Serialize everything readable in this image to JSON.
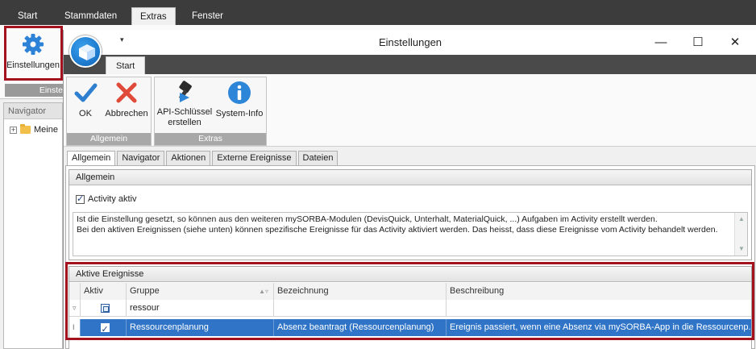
{
  "main": {
    "tabs": [
      {
        "label": "Start"
      },
      {
        "label": "Stammdaten"
      },
      {
        "label": "Extras"
      },
      {
        "label": "Fenster"
      }
    ],
    "ribbon_button": {
      "label": "Einstellungen",
      "icon": "gear-icon"
    },
    "group_caption": "Einste",
    "navigator": {
      "header": "Navigator",
      "item": "Meine"
    }
  },
  "dialog": {
    "title": "Einstellungen",
    "quick_access": "▾",
    "window_buttons": {
      "minimize": "—",
      "maximize": "☐",
      "close": "✕"
    },
    "ribbon_tab": "Start",
    "groups": [
      {
        "caption": "Allgemein",
        "buttons": [
          {
            "label": "OK",
            "icon": "checkmark-icon"
          },
          {
            "label": "Abbrechen",
            "icon": "cancel-x-icon"
          }
        ]
      },
      {
        "caption": "Extras",
        "buttons": [
          {
            "label": "API-Schlüssel erstellen",
            "line1": "API-Schlüssel",
            "line2": "erstellen",
            "icon": "key-icon"
          },
          {
            "label": "System-Info",
            "icon": "info-icon"
          }
        ]
      }
    ],
    "sub_tabs": [
      "Allgemein",
      "Navigator",
      "Aktionen",
      "Externe Ereignisse",
      "Dateien"
    ],
    "general": {
      "header": "Allgemein",
      "checkbox_label": "Activity aktiv",
      "checkbox_checked": true,
      "description_line1": "Ist die Einstellung gesetzt, so können aus den weiteren mySORBA-Modulen (DevisQuick, Unterhalt, MaterialQuick, ...) Aufgaben im Activity erstellt werden.",
      "description_line2": "Bei den aktiven Ereignissen (siehe unten) können spezifische Ereignisse für das Activity aktiviert werden. Das heisst, dass diese Ereignisse vom Activity behandelt werden."
    },
    "events": {
      "header": "Aktive Ereignisse",
      "columns": [
        "Aktiv",
        "Gruppe",
        "Bezeichnung",
        "Beschreibung"
      ],
      "filter_row": {
        "gruppe": "ressour",
        "bezeichnung": "",
        "beschreibung": ""
      },
      "rows": [
        {
          "aktiv": true,
          "gruppe": "Ressourcenplanung",
          "bezeichnung": "Absenz beantragt (Ressourcenplanung)",
          "beschreibung": "Ereignis passiert, wenn eine Absenz via mySORBA-App in die Ressourcenp..."
        }
      ]
    }
  },
  "colors": {
    "accent": "#2f74c7",
    "highlight_border": "#a3121e",
    "dark_chrome": "#3c3c3c"
  }
}
